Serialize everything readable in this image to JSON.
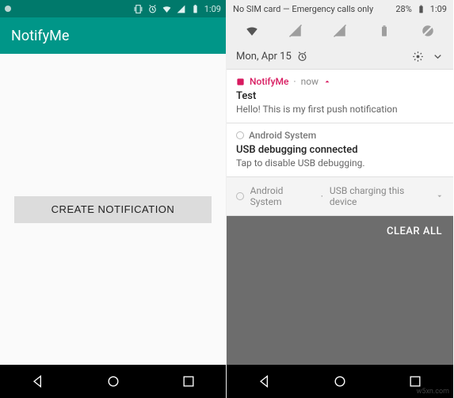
{
  "left": {
    "status_time": "1:09",
    "app_title": "NotifyMe",
    "button_label": "CREATE NOTIFICATION"
  },
  "right": {
    "status_text": "No SIM card — Emergency calls only",
    "battery_pct": "28%",
    "status_time": "1:09",
    "date_label": "Mon, Apr 15",
    "notif1": {
      "app": "NotifyMe",
      "time": "now",
      "title": "Test",
      "body": "Hello! This is my first push notification"
    },
    "notif2": {
      "app": "Android System",
      "title": "USB debugging connected",
      "body": "Tap to disable USB debugging."
    },
    "notif3": {
      "app": "Android System",
      "summary": "USB charging this device"
    },
    "clear_all": "CLEAR ALL"
  },
  "watermark": "w5xn.com"
}
